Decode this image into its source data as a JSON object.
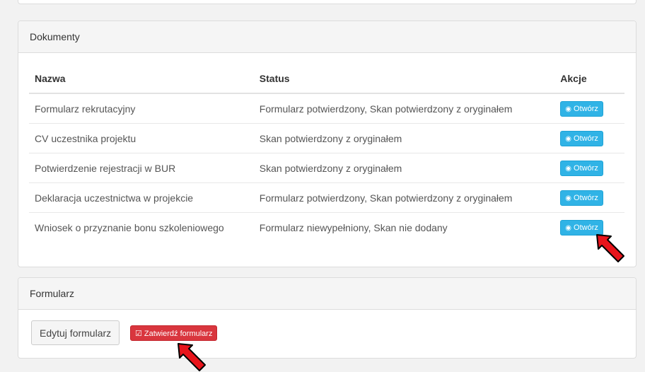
{
  "documents": {
    "title": "Dokumenty",
    "columns": {
      "name": "Nazwa",
      "status": "Status",
      "actions": "Akcje"
    },
    "open_label": "Otwórz",
    "rows": [
      {
        "name": "Formularz rekrutacyjny",
        "status": "Formularz potwierdzony, Skan potwierdzony z oryginałem"
      },
      {
        "name": "CV uczestnika projektu",
        "status": "Skan potwierdzony z oryginałem"
      },
      {
        "name": "Potwierdzenie rejestracji w BUR",
        "status": "Skan potwierdzony z oryginałem"
      },
      {
        "name": "Deklaracja uczestnictwa w projekcie",
        "status": "Formularz potwierdzony, Skan potwierdzony z oryginałem"
      },
      {
        "name": "Wniosek o przyznanie bonu szkoleniowego",
        "status": "Formularz niewypełniony, Skan nie dodany"
      }
    ]
  },
  "form": {
    "title": "Formularz",
    "edit_label": "Edytuj formularz",
    "confirm_label": "Zatwierdź formularz"
  },
  "colors": {
    "open_button": "#30b3e6",
    "confirm_button": "#d9363e",
    "arrow": "#e8141b"
  },
  "icons": {
    "open": "eye-icon",
    "confirm": "check-square-icon",
    "annotation": "red-arrow-icon"
  }
}
